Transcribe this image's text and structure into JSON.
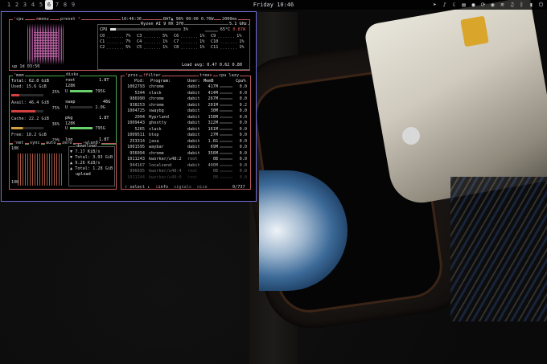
{
  "topbar": {
    "workspaces": [
      "1",
      "2",
      "3",
      "4",
      "5",
      "6",
      "7",
      "8",
      "9"
    ],
    "active_workspace_index": 5,
    "clock": "Friday 10:46",
    "tray_icons": [
      "send-icon",
      "bell-icon",
      "moon-icon",
      "clipboard-icon",
      "record-icon",
      "sync-icon",
      "globe-icon",
      "wifi-icon",
      "volume-icon",
      "bluetooth-icon",
      "battery-icon",
      "power-icon"
    ]
  },
  "btop": {
    "cpu": {
      "label": "cpu",
      "menu": "menu",
      "preset": "preset",
      "time": "10:46:36",
      "battery": "BAT▲ 98% 00:00 0.76W",
      "refresh": "2000ms",
      "uptime": "up 1d 03:50",
      "model": "Ryzen AI 9 HX 370",
      "freq": "5.1 GHz",
      "total_label": "CPU",
      "total_pct": "3%",
      "temp": "65°C",
      "temp2": "0.87W",
      "cores": [
        {
          "name": "C0",
          "pct": "7%"
        },
        {
          "name": "C3",
          "pct": "5%"
        },
        {
          "name": "C6",
          "pct": "1%"
        },
        {
          "name": "C9",
          "pct": "1%"
        },
        {
          "name": "C1",
          "pct": "7%"
        },
        {
          "name": "C4",
          "pct": "1%"
        },
        {
          "name": "C7",
          "pct": "1%"
        },
        {
          "name": "C10",
          "pct": "1%"
        },
        {
          "name": "C2",
          "pct": "5%"
        },
        {
          "name": "C5",
          "pct": "1%"
        },
        {
          "name": "C8",
          "pct": "1%"
        },
        {
          "name": "C11",
          "pct": "1%"
        }
      ],
      "load_avg": "Load avg: 0.47 0.62 0.80"
    },
    "mem": {
      "label": "mem",
      "total": "Total:   62.0 GiB",
      "used": "Used:    15.6 GiB",
      "used_pct": "25%",
      "avail": "Avail:   46.4 GiB",
      "avail_pct": "75%",
      "cache": "Cache:   22.2 GiB",
      "cache_pct": "36%",
      "free": "Free:    18.2 GiB",
      "free_pct": "29%"
    },
    "disks": {
      "label": "disks",
      "root_name": "root",
      "root_size": "1.8T",
      "root_io": "128K",
      "root_used": "795G",
      "swap_name": "swap",
      "swap_size": "46G",
      "swap_used": "2.0G",
      "pkg_name": "pkg",
      "pkg_size": "1.8T",
      "pkg_io": "128K",
      "pkg_used": "795G",
      "log_name": "log",
      "log_size": "1.8T"
    },
    "net": {
      "label": "net",
      "sync": "sync",
      "auto": "auto",
      "zero": "zero",
      "iface": "wlan0",
      "scale_top": "10K",
      "scale_bot": "10K",
      "download": "download",
      "dl_rate": "7.17 KiB/s",
      "dl_total": "Total: 3.93 GiB",
      "ul_rate": "9.26 KiB/s",
      "ul_total": "Total: 1.28 GiB",
      "upload": "upload"
    },
    "proc": {
      "label": "proc",
      "filter": "filter",
      "tree": "tree",
      "cpu_lazy": "cpu lazy",
      "headers": [
        "Pid:",
        "Program:",
        "User:",
        "MemB",
        "Cpu%"
      ],
      "rows": [
        {
          "pid": "1002793",
          "prog": "chrome",
          "user": "dabit",
          "mem": "417M",
          "cpu": "0.0"
        },
        {
          "pid": "5344",
          "prog": "slack",
          "user": "dabit",
          "mem": "414M",
          "cpu": "0.0"
        },
        {
          "pid": "986990",
          "prog": "chrome",
          "user": "dabit",
          "mem": "267M",
          "cpu": "0.0"
        },
        {
          "pid": "938253",
          "prog": "chrome",
          "user": "dabit",
          "mem": "201M",
          "cpu": "0.2"
        },
        {
          "pid": "1004725",
          "prog": "swaybg",
          "user": "dabit",
          "mem": "30M",
          "cpu": "0.0"
        },
        {
          "pid": "2094",
          "prog": "Hyprland",
          "user": "dabit",
          "mem": "158M",
          "cpu": "0.0"
        },
        {
          "pid": "1009443",
          "prog": "ghostty",
          "user": "dabit",
          "mem": "322M",
          "cpu": "0.0"
        },
        {
          "pid": "5265",
          "prog": "slack",
          "user": "dabit",
          "mem": "161M",
          "cpu": "0.0"
        },
        {
          "pid": "1009511",
          "prog": "btop",
          "user": "dabit",
          "mem": "27M",
          "cpu": "0.0"
        },
        {
          "pid": "253314",
          "prog": "java",
          "user": "dabit",
          "mem": "1.6G",
          "cpu": "0.0"
        },
        {
          "pid": "1001595",
          "prog": "waybar",
          "user": "dabit",
          "mem": "69M",
          "cpu": "0.0"
        },
        {
          "pid": "956094",
          "prog": "chrome",
          "user": "dabit",
          "mem": "356M",
          "cpu": "0.0"
        },
        {
          "pid": "1011243",
          "prog": "kworker/u48:2",
          "user": "root",
          "mem": "0B",
          "cpu": "0.0"
        },
        {
          "pid": "944167",
          "prog": "localsend",
          "user": "dabit",
          "mem": "400M",
          "cpu": "0.0"
        },
        {
          "pid": "996695",
          "prog": "kworker/u48:4",
          "user": "root",
          "mem": "0B",
          "cpu": "0.0"
        },
        {
          "pid": "1011244",
          "prog": "kworker/u48:0",
          "user": "root",
          "mem": "0B",
          "cpu": "0.0"
        }
      ],
      "footer_select": "select",
      "footer_info": "info",
      "footer_signals": "signals",
      "footer_nice": "nice",
      "count": "0/737"
    }
  },
  "colors": {
    "border_window": "#6e6ed8",
    "cpu_box": "#c35a5a",
    "mem_box": "#4ea64e",
    "graph_pink": "#b45ea6",
    "bar_green": "#6ad06a"
  }
}
